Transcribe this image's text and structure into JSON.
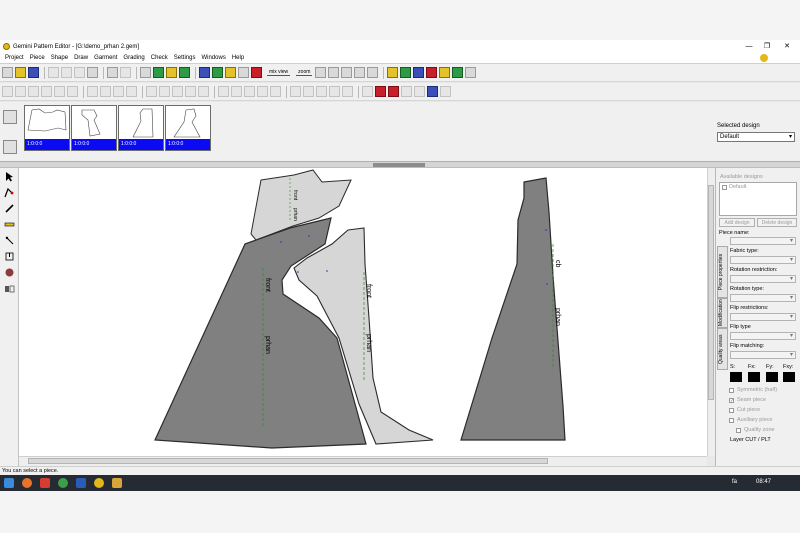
{
  "window": {
    "title": "Gemini Pattern Editor - [G:\\demo_prhan 2.gem]",
    "minimize": "—",
    "maximize": "❐",
    "close": "✕"
  },
  "menu": [
    "Project",
    "Piece",
    "Shape",
    "Draw",
    "Garment",
    "Grading",
    "Check",
    "Settings",
    "Windows",
    "Help"
  ],
  "toolbar": {
    "mix_view_label": "mix view",
    "zoom_label": "zoom"
  },
  "thumbnails": [
    {
      "caption": "1:0:0:0"
    },
    {
      "caption": "1:0:0:0"
    },
    {
      "caption": "1:0:0:0"
    },
    {
      "caption": "1:0:0:0"
    }
  ],
  "selected_design": {
    "label": "Selected design",
    "value": "Default"
  },
  "pieces": {
    "front_label": "front",
    "prhan_label": "prhan",
    "cb_label": "cb"
  },
  "right_panel": {
    "available_designs": "Available designs",
    "default_design": "Default",
    "add_design": "Add design",
    "delete_design": "Delete design",
    "piece_name": "Piece name:",
    "fabric_type": "Fabric type:",
    "rotation_restriction": "Rotation restriction:",
    "rotation_type": "Rotation type:",
    "flip_restrictions": "Flip restrictions:",
    "flip_type": "Flip type",
    "flip_matching": "Flip matching:",
    "s_label": "S:",
    "fx_label": "Fx:",
    "fy_label": "Fy:",
    "fxy_label": "Fxy:",
    "symmetric": "Symmetric (half)",
    "seam_piece": "Seam piece",
    "cut_piece": "Cut piece",
    "auxiliary_piece": "Auxiliary piece",
    "quality_zone": "Quality zone",
    "layer": "Layer CUT / PLT",
    "tab_piece_properties": "Piece properties",
    "tab_modification": "Modification",
    "tab_quality_areas": "Quality areas"
  },
  "status": "You can select a piece.",
  "taskbar": {
    "lang": "fa",
    "time": "08:47"
  },
  "colors": {
    "piece_dark": "#808080",
    "piece_light": "#d6d6d6",
    "thumb_caption": "#0a0af5",
    "grainline": "#2c8a2c"
  }
}
